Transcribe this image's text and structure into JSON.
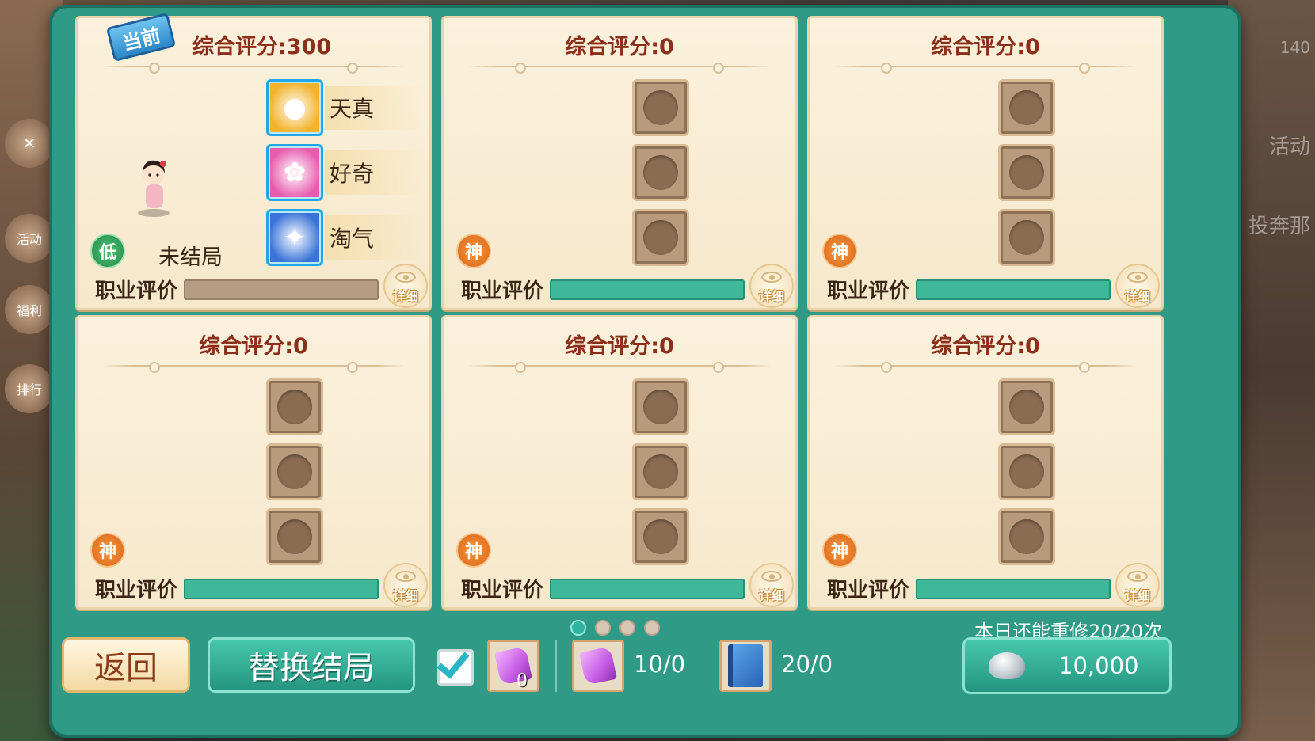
{
  "background": {
    "left_labels": [
      "活动",
      "福利",
      "排行"
    ],
    "right_labels": [
      "活动",
      "投奔那"
    ],
    "right_level": "140"
  },
  "cards": [
    {
      "title": "综合评分:300",
      "is_current": true,
      "current_badge": "当前",
      "traits": [
        {
          "icon": "candied-haws-icon",
          "glyph": "●",
          "color": "#f2b32a",
          "label": "天真"
        },
        {
          "icon": "lollipop-icon",
          "glyph": "✿",
          "color": "#e85cb0",
          "label": "好奇"
        },
        {
          "icon": "kite-icon",
          "glyph": "✦",
          "color": "#3a74d8",
          "label": "淘气"
        }
      ],
      "grade": "低",
      "grade_type": "low",
      "status": "未结局",
      "eval_label": "职业评价",
      "eval_filled": false,
      "detail_label": "详细"
    },
    {
      "title": "综合评分:0",
      "is_current": false,
      "grade": "神",
      "grade_type": "god",
      "eval_label": "职业评价",
      "eval_filled": true,
      "detail_label": "详细"
    },
    {
      "title": "综合评分:0",
      "is_current": false,
      "grade": "神",
      "grade_type": "god",
      "eval_label": "职业评价",
      "eval_filled": true,
      "detail_label": "详细"
    },
    {
      "title": "综合评分:0",
      "is_current": false,
      "grade": "神",
      "grade_type": "god",
      "eval_label": "职业评价",
      "eval_filled": true,
      "detail_label": "详细"
    },
    {
      "title": "综合评分:0",
      "is_current": false,
      "grade": "神",
      "grade_type": "god",
      "eval_label": "职业评价",
      "eval_filled": true,
      "detail_label": "详细"
    },
    {
      "title": "综合评分:0",
      "is_current": false,
      "grade": "神",
      "grade_type": "god",
      "eval_label": "职业评价",
      "eval_filled": true,
      "detail_label": "详细"
    }
  ],
  "pagination": {
    "total": 4,
    "active": 0
  },
  "bottom": {
    "back_label": "返回",
    "replace_label": "替换结局",
    "checkbox_checked": true,
    "scroll_small_count": "0",
    "scroll_count": "10/0",
    "book_count": "20/0",
    "redo_text": "本日还能重修20/20次",
    "cost": "10,000"
  },
  "colors": {
    "panel": "#2f9a86",
    "title_text": "#8b2f1a",
    "eval_bar": "#3fb89a",
    "grade_god": "#e8762a",
    "grade_low": "#2fa35a"
  }
}
